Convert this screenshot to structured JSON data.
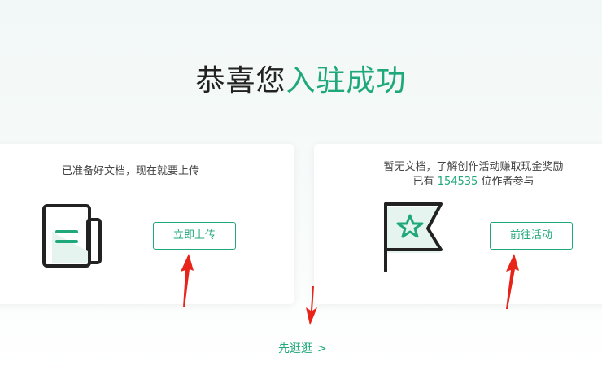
{
  "header": {
    "title_prefix": "恭喜您",
    "title_accent": "入驻成功"
  },
  "left_card": {
    "description": "已准备好文档，现在就要上传",
    "button_label": "立即上传",
    "icon": "document-icon"
  },
  "right_card": {
    "line1": "暂无文档，了解创作活动赚取现金奖励",
    "line2_prefix": "已有 ",
    "participant_count": "154535",
    "line2_suffix": " 位作者参与",
    "button_label": "前往活动",
    "icon": "flag-star-icon"
  },
  "footer": {
    "stroll_label": "先逛逛",
    "chevron": ">"
  },
  "colors": {
    "accent": "#1fa87b",
    "annotation_arrow": "#e8231a"
  }
}
